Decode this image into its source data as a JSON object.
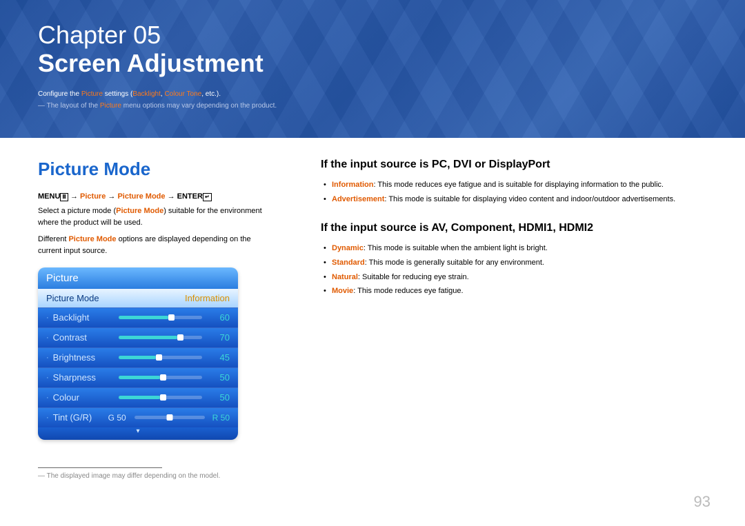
{
  "banner": {
    "chapter_label": "Chapter 05",
    "title": "Screen Adjustment",
    "intro_prefix": "Configure the ",
    "intro_hl1": "Picture",
    "intro_mid": " settings (",
    "intro_hl2": "Backlight",
    "intro_sep": ", ",
    "intro_hl3": "Colour Tone",
    "intro_suffix": ", etc.).",
    "note_prefix": "―  The layout of the ",
    "note_hl": "Picture",
    "note_suffix": " menu options may vary depending on the product."
  },
  "left": {
    "section_title": "Picture Mode",
    "path_menu": "MENU",
    "path_arrow": " → ",
    "path_hl1": "Picture",
    "path_hl2": "Picture Mode",
    "path_enter": "ENTER",
    "menu_glyph": "Ⅲ",
    "enter_glyph": "↵",
    "p1a": "Select a picture mode (",
    "p1hl": "Picture Mode",
    "p1b": ") suitable for the environment where the product will be used.",
    "p2a": "Different ",
    "p2hl": "Picture Mode",
    "p2b": " options are displayed depending on the current input source.",
    "footnote": "―  The displayed image may differ depending on the model."
  },
  "osd": {
    "header": "Picture",
    "selected_label": "Picture Mode",
    "selected_value": "Information",
    "rows": [
      {
        "label": "Backlight",
        "value": "60",
        "pct": 60
      },
      {
        "label": "Contrast",
        "value": "70",
        "pct": 70
      },
      {
        "label": "Brightness",
        "value": "45",
        "pct": 45
      },
      {
        "label": "Sharpness",
        "value": "50",
        "pct": 50
      },
      {
        "label": "Colour",
        "value": "50",
        "pct": 50
      }
    ],
    "tint_label": "Tint (G/R)",
    "tint_g": "G 50",
    "tint_r": "R 50",
    "footer_arrow": "▾"
  },
  "right": {
    "h1": "If the input source is PC, DVI or DisplayPort",
    "list1": [
      {
        "hl": "Information",
        "text": ": This mode reduces eye fatigue and is suitable for displaying information to the public."
      },
      {
        "hl": "Advertisement",
        "text": ": This mode is suitable for displaying video content and indoor/outdoor advertisements."
      }
    ],
    "h2": "If the input source is AV, Component, HDMI1, HDMI2",
    "list2": [
      {
        "hl": "Dynamic",
        "text": ": This mode is suitable when the ambient light is bright."
      },
      {
        "hl": "Standard",
        "text": ": This mode is generally suitable for any environment."
      },
      {
        "hl": "Natural",
        "text": ": Suitable for reducing eye strain."
      },
      {
        "hl": "Movie",
        "text": ": This mode reduces eye fatigue."
      }
    ]
  },
  "page_number": "93"
}
